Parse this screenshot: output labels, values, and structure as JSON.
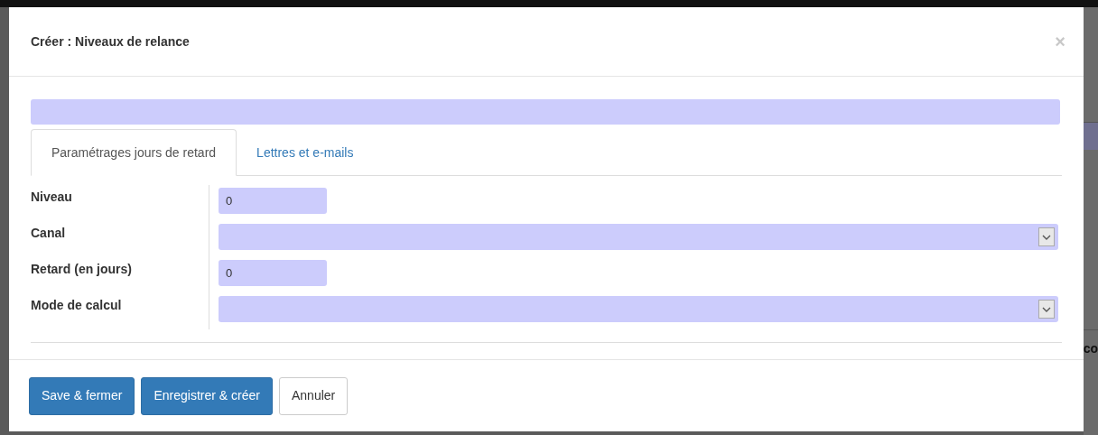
{
  "background": {
    "text": "co"
  },
  "dialog": {
    "title": "Créer : Niveaux de relance",
    "close": "×"
  },
  "tabs": [
    {
      "label": "Paramétrages jours de retard",
      "selected": true
    },
    {
      "label": "Lettres et e-mails",
      "selected": false
    }
  ],
  "fields": [
    {
      "label": "Niveau",
      "kind": "number",
      "value": "0"
    },
    {
      "label": "Canal",
      "kind": "select"
    },
    {
      "label": "Retard (en jours)",
      "kind": "number",
      "value": "0"
    },
    {
      "label": "Mode de calcul",
      "kind": "select"
    }
  ],
  "buttons": [
    {
      "label": "Save & fermer",
      "kind": "primary"
    },
    {
      "label": "Enregistrer & créer",
      "kind": "primary"
    },
    {
      "label": "Annuler",
      "kind": "default"
    }
  ]
}
